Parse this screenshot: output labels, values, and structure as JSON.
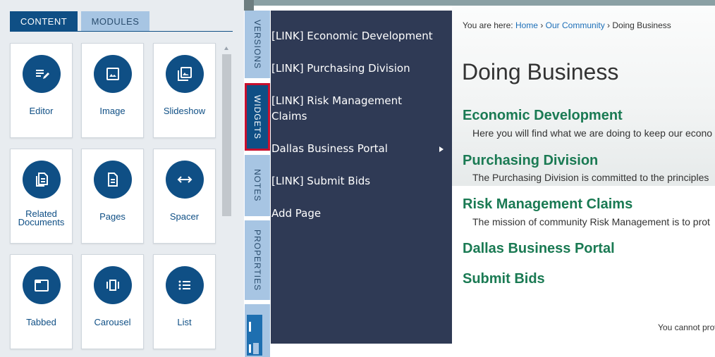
{
  "panel": {
    "tabs": [
      {
        "label": "CONTENT"
      },
      {
        "label": "MODULES"
      }
    ],
    "widgets": [
      {
        "label": "Editor",
        "icon": "editor-icon"
      },
      {
        "label": "Image",
        "icon": "image-icon"
      },
      {
        "label": "Slideshow",
        "icon": "slideshow-icon"
      },
      {
        "label": "Related Documents",
        "icon": "related-documents-icon"
      },
      {
        "label": "Pages",
        "icon": "pages-icon"
      },
      {
        "label": "Spacer",
        "icon": "spacer-icon"
      },
      {
        "label": "Tabbed",
        "icon": "tabbed-icon"
      },
      {
        "label": "Carousel",
        "icon": "carousel-icon"
      },
      {
        "label": "List",
        "icon": "list-icon"
      }
    ]
  },
  "side_tabs": {
    "versions": "VERSIONS",
    "widgets": "WIDGETS",
    "notes": "NOTES",
    "properties": "PROPERTIES"
  },
  "flyout": {
    "items": [
      "[LINK] Economic Development",
      "[LINK] Purchasing Division",
      "[LINK] Risk Management Claims",
      "Dallas Business Portal",
      "[LINK] Submit Bids",
      "Add Page"
    ]
  },
  "page": {
    "breadcrumb": {
      "prefix": "You are here:",
      "home": "Home",
      "community": "Our Community",
      "current": "Doing Business"
    },
    "title": "Doing Business",
    "sections": [
      {
        "heading": "Economic Development",
        "desc": "Here you will find what we are doing to keep our econo"
      },
      {
        "heading": "Purchasing Division",
        "desc": "The Purchasing Division is committed to the principles"
      },
      {
        "heading": "Risk Management Claims",
        "desc": "The mission of community Risk Management is to prot"
      },
      {
        "heading": "Dallas Business Portal",
        "desc": ""
      },
      {
        "heading": "Submit Bids",
        "desc": ""
      }
    ],
    "footer_note": "You cannot prov"
  },
  "colors": {
    "brand_blue": "#0f4f85",
    "light_blue": "#a7c5e3",
    "flyout_bg": "#2f3a55",
    "heading_green": "#1a7a53",
    "highlight_red": "#c8102e"
  }
}
